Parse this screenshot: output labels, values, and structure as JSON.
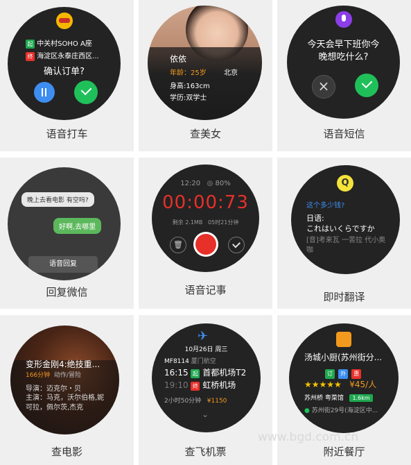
{
  "captions": [
    "语音打车",
    "查美女",
    "语音短信",
    "回复微信",
    "语音记事",
    "即时翻译",
    "查电影",
    "查飞机票",
    "附近餐厅"
  ],
  "taxi": {
    "from_tag": "起",
    "from": "中关村SOHO A座",
    "to_tag": "终",
    "to": "海淀区永泰庄西区...",
    "confirm": "确认订单?"
  },
  "beauty": {
    "name": "依依",
    "age": "年龄：25岁",
    "city": "北京",
    "height": "身高:163cm",
    "edu": "学历:双学士"
  },
  "sms": {
    "message": "今天会早下班你今晚想吃什么?"
  },
  "wechat": {
    "incoming": "晚上去看电影 有空吗?",
    "outgoing": "好啊,去哪里",
    "reply_button": "语音回复"
  },
  "memo": {
    "time": "12:20",
    "battery": "80%",
    "timer": "00:00:73",
    "remaining": "剩余 2.1MB",
    "duration": "05时21分钟"
  },
  "translate": {
    "question": "这个多少钱?",
    "label": "日语:",
    "japanese": "これはいくらですか",
    "phonetic": "[音]考来瓦 一苦拉 代小奥咖"
  },
  "movie": {
    "title": "变形金刚4:绝技重...",
    "minutes": "166分钟",
    "genre": "动作/冒险",
    "director": "导演：迈克尔・贝",
    "cast": "主演：马克，沃尔伯格,妮可拉，佩尔茨,杰克"
  },
  "flight": {
    "date": "10月26日 周三",
    "flight_no": "MF8114",
    "airline": "厦门航空",
    "dep_time": "16:15",
    "dep_tag": "起",
    "dep_airport": "首都机场T2",
    "arr_time": "19:10",
    "arr_tag": "终",
    "arr_airport": "虹桥机场",
    "duration": "2小时50分钟",
    "price": "¥1150"
  },
  "restaurant": {
    "name": "汤城小厨(苏州街分...",
    "tag_ding": "订",
    "tag_wai": "外",
    "tag_hui": "惠",
    "stars": "★★★★★",
    "price": "¥45/人",
    "area": "苏州桥 粤菜馆",
    "distance": "1.6km",
    "address": "苏州街29号(海淀区中..."
  },
  "watermark": "www.bgd.com.cn",
  "colors": {
    "green": "#1fc05a",
    "blue": "#3d8ef0",
    "orange": "#f29a1e",
    "red": "#e8302a",
    "purple": "#8b3ee8"
  }
}
